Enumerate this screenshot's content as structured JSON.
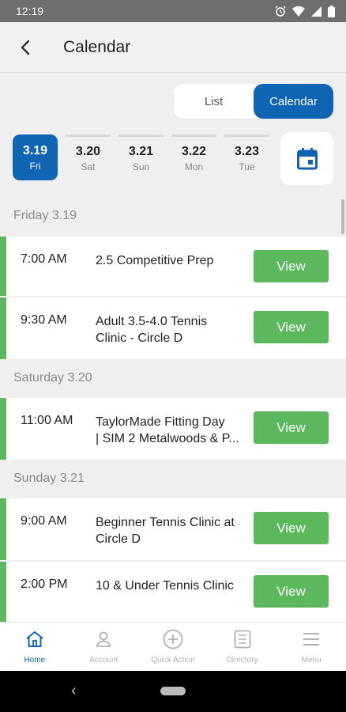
{
  "status_bar": {
    "time": "12:19"
  },
  "app_bar": {
    "title": "Calendar"
  },
  "view_toggle": {
    "list_label": "List",
    "calendar_label": "Calendar"
  },
  "dates": [
    {
      "num": "3.19",
      "day": "Fri"
    },
    {
      "num": "3.20",
      "day": "Sat"
    },
    {
      "num": "3.21",
      "day": "Sun"
    },
    {
      "num": "3.22",
      "day": "Mon"
    },
    {
      "num": "3.23",
      "day": "Tue"
    }
  ],
  "sections": [
    {
      "header": "Friday 3.19"
    },
    {
      "header": "Saturday 3.20"
    },
    {
      "header": "Sunday 3.21"
    }
  ],
  "events": [
    {
      "time": "7:00 AM",
      "title": "2.5 Competitive Prep",
      "button": "View"
    },
    {
      "time": "9:30 AM",
      "title": "Adult 3.5-4.0 Tennis",
      "title2": "Clinic - Circle D",
      "button": "View"
    },
    {
      "time": "11:00 AM",
      "title": "TaylorMade Fitting Day",
      "title2": "| SIM 2 Metalwoods & P...",
      "button": "View"
    },
    {
      "time": "9:00 AM",
      "title": "Beginner Tennis Clinic at",
      "title2": "Circle D",
      "button": "View"
    },
    {
      "time": "2:00 PM",
      "title": "10 & Under Tennis Clinic",
      "button": "View"
    }
  ],
  "bottom_nav": [
    {
      "label": "Home",
      "icon": "home-icon"
    },
    {
      "label": "Account",
      "icon": "person-icon"
    },
    {
      "label": "Quick Action",
      "icon": "plus-circle-icon"
    },
    {
      "label": "Directory",
      "icon": "directory-icon"
    },
    {
      "label": "Menu",
      "icon": "menu-icon"
    }
  ],
  "colors": {
    "primary": "#0f64b4",
    "accent_green": "#5cb85c"
  }
}
